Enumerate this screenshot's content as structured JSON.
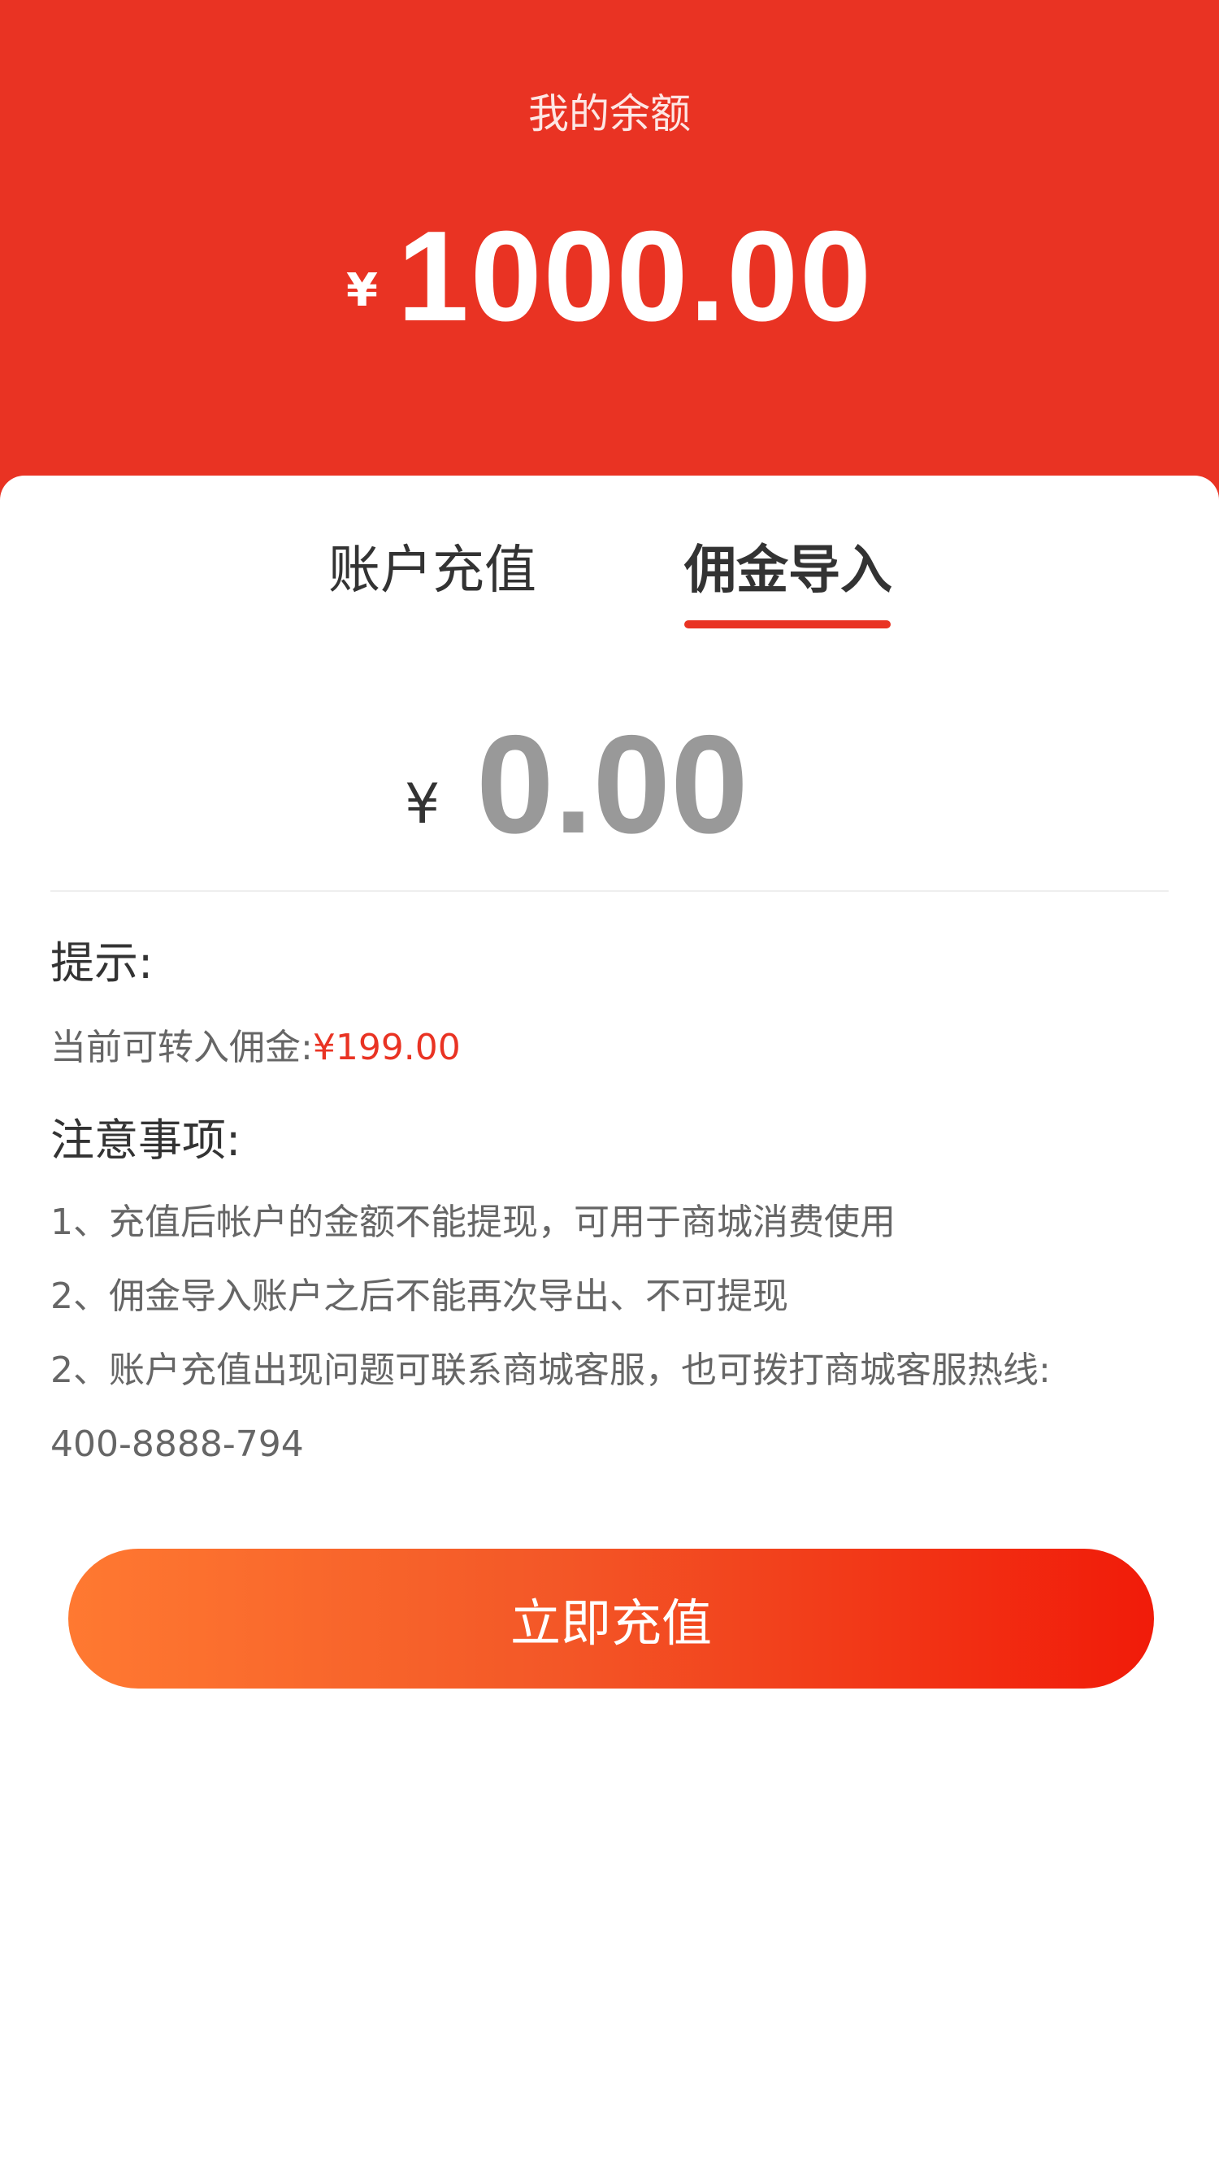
{
  "header": {
    "balance_label": "我的余额",
    "currency_symbol": "¥",
    "balance": "1000.00",
    "background_color": "#e93323"
  },
  "tabs": [
    {
      "label": "账户充值",
      "active": false
    },
    {
      "label": "佣金导入",
      "active": true
    }
  ],
  "amount": {
    "currency_symbol": "¥",
    "placeholder": "0.00"
  },
  "tips": {
    "title": "提示:",
    "commission_label": "当前可转入佣金:",
    "commission_value": "¥199.00"
  },
  "notes": {
    "title": "注意事项:",
    "items": [
      "1、充值后帐户的金额不能提现，可用于商城消费使用",
      "2、佣金导入账户之后不能再次导出、不可提现",
      "2、账户充值出现问题可联系商城客服，也可拨打商城客服热线:",
      "400-8888-794"
    ]
  },
  "button": {
    "label": "立即充值",
    "gradient_colors": [
      "#ff7931",
      "#f11b09"
    ]
  },
  "accent_color": "#e93323"
}
